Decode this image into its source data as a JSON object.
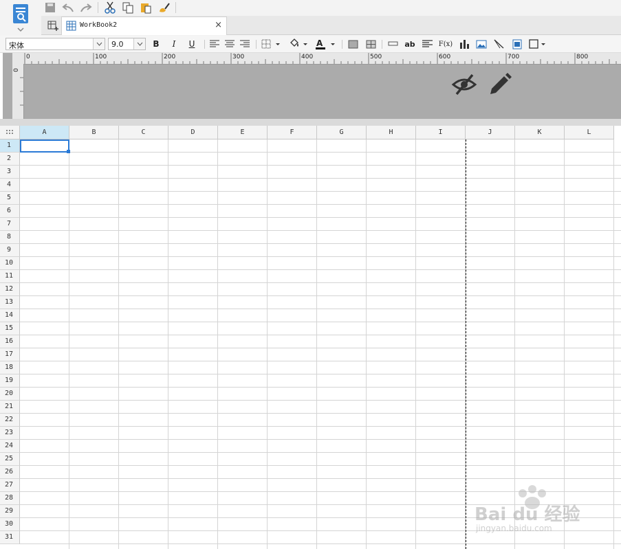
{
  "window": {
    "tab_title": "WorkBook2",
    "close_glyph": "×"
  },
  "format_bar": {
    "font_name": "宋体",
    "font_size": "9.0",
    "bold": "B",
    "italic": "I",
    "underline": "U",
    "wrap_label": "ab",
    "formula_label": "F(x)"
  },
  "ruler": {
    "marks": [
      "0",
      "100",
      "200",
      "300",
      "400",
      "500",
      "600",
      "700",
      "800"
    ],
    "vertical_mark": "0"
  },
  "columns": [
    "A",
    "B",
    "C",
    "D",
    "E",
    "F",
    "G",
    "H",
    "I",
    "J",
    "K",
    "L"
  ],
  "rows": [
    "1",
    "2",
    "3",
    "4",
    "5",
    "6",
    "7",
    "8",
    "9",
    "10",
    "11",
    "12",
    "13",
    "14",
    "15",
    "16",
    "17",
    "18",
    "19",
    "20",
    "21",
    "22",
    "23",
    "24",
    "25",
    "26",
    "27",
    "28",
    "29",
    "30",
    "31"
  ],
  "selected_cell": "A1",
  "watermark": {
    "brand": "Bai du 经验",
    "url": "jingyan.baidu.com"
  },
  "colors": {
    "accent": "#2a7ad6",
    "selected_header": "#cde8f6",
    "band": "#ababab"
  }
}
